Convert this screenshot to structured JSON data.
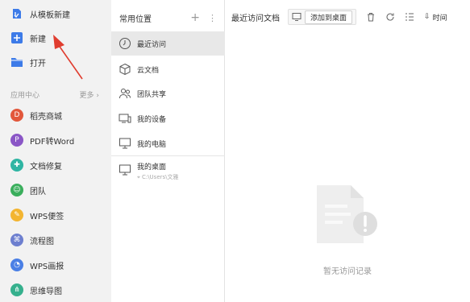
{
  "left_nav": {
    "top_items": [
      {
        "label": "从模板新建",
        "icon": "template-icon"
      },
      {
        "label": "新建",
        "icon": "new-plus-icon"
      },
      {
        "label": "打开",
        "icon": "folder-icon"
      }
    ],
    "section_title": "应用中心",
    "more_label": "更多",
    "apps": [
      {
        "label": "稻壳商城",
        "icon": "docer-store-icon",
        "color": "#e2573b"
      },
      {
        "label": "PDF转Word",
        "icon": "pdf-convert-icon",
        "color": "#8a56c6"
      },
      {
        "label": "文档修复",
        "icon": "doc-repair-icon",
        "color": "#2fb5a3"
      },
      {
        "label": "团队",
        "icon": "team-icon",
        "color": "#3aae5c"
      },
      {
        "label": "WPS便签",
        "icon": "notes-icon",
        "color": "#f3b531"
      },
      {
        "label": "流程图",
        "icon": "flowchart-icon",
        "color": "#6d7fcf"
      },
      {
        "label": "WPS画报",
        "icon": "poster-icon",
        "color": "#4a7fe5"
      },
      {
        "label": "思维导图",
        "icon": "mindmap-icon",
        "color": "#35b08d"
      }
    ]
  },
  "middle": {
    "title": "常用位置",
    "items": [
      {
        "label": "最近访问",
        "icon": "clock-icon",
        "active": true
      },
      {
        "label": "云文档",
        "icon": "cloud-box-icon"
      },
      {
        "label": "团队共享",
        "icon": "team-share-icon"
      },
      {
        "label": "我的设备",
        "icon": "device-icon"
      },
      {
        "label": "我的电脑",
        "icon": "computer-icon"
      }
    ],
    "desktop": {
      "label": "我的桌面",
      "path": "C:\\Users\\文雅"
    }
  },
  "right": {
    "title": "最近访问文档",
    "add_desktop_label": "添加到桌面",
    "time_label": "时间",
    "empty_text": "暂无访问记录"
  },
  "colors": {
    "accent": "#3d7be8",
    "arrow": "#e03d2f"
  }
}
